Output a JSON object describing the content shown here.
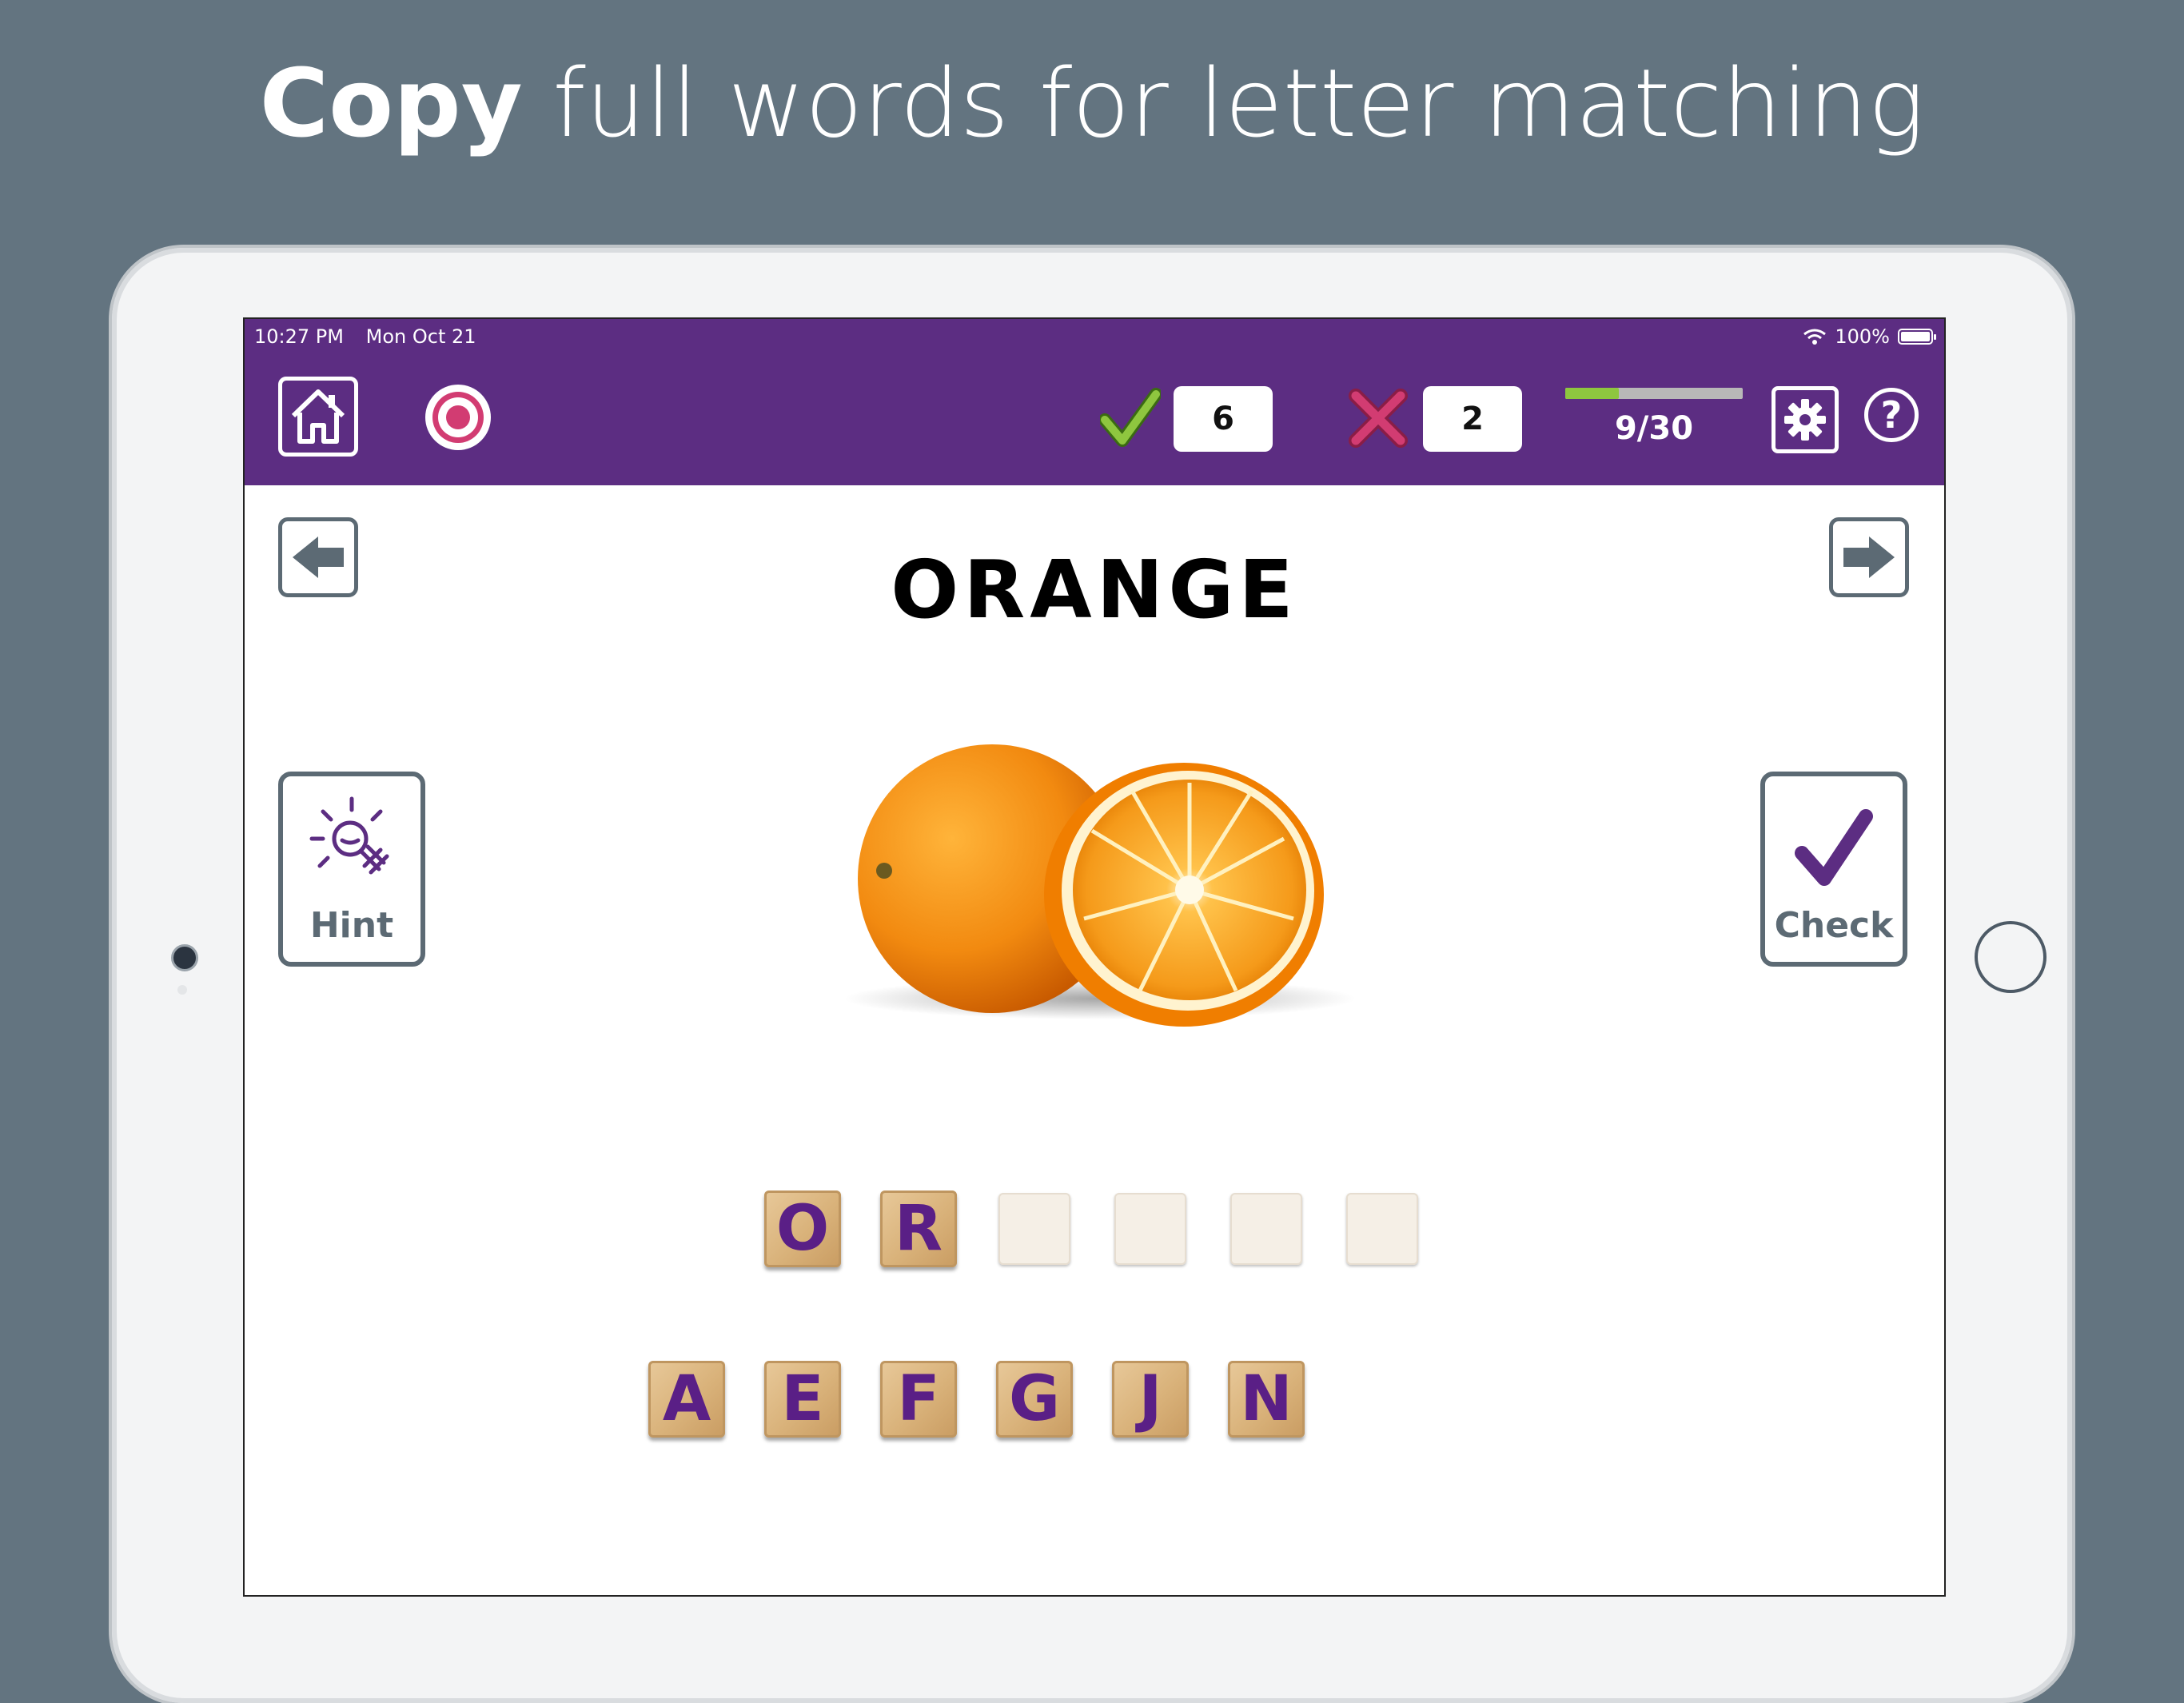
{
  "headline": {
    "bold": "Copy",
    "rest": " full words for letter matching"
  },
  "status_bar": {
    "time": "10:27 PM",
    "date": "Mon Oct 21",
    "battery": "100%"
  },
  "scores": {
    "correct": "6",
    "incorrect": "2"
  },
  "progress": {
    "text": "9/30",
    "fraction": 0.3
  },
  "help": {
    "label": "?"
  },
  "word": "ORANGE",
  "hint_button": {
    "label": "Hint"
  },
  "check_button": {
    "label": "Check"
  },
  "answer_slots": [
    "O",
    "R",
    "",
    "",
    "",
    ""
  ],
  "letter_choices": [
    "A",
    "E",
    "F",
    "G",
    "J",
    "N"
  ],
  "colors": {
    "brand_purple": "#5c2d82",
    "background": "#637480",
    "correct_green": "#8ec63f",
    "incorrect_pink": "#d23c72",
    "tile_letter": "#5a1f86"
  }
}
